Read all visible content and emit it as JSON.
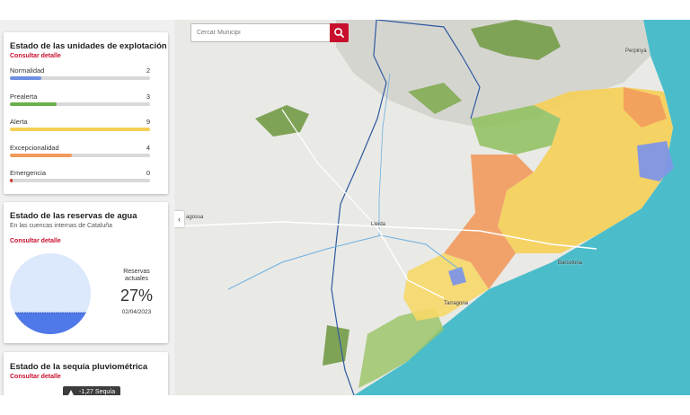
{
  "search": {
    "placeholder": "Cercar Municipi"
  },
  "exploitation": {
    "title": "Estado de las unidades de explotación",
    "detail_link": "Consultar detalle",
    "max": 9,
    "rows": [
      {
        "label": "Normalidad",
        "count": "2",
        "value": 2,
        "color": "#6f8fe0"
      },
      {
        "label": "Prealerta",
        "count": "3",
        "value": 3,
        "color": "#6ab04c"
      },
      {
        "label": "Alerta",
        "count": "9",
        "value": 9,
        "color": "#f6cf55"
      },
      {
        "label": "Excepcionalidad",
        "count": "4",
        "value": 4,
        "color": "#f29a5c"
      },
      {
        "label": "Emergencia",
        "count": "0",
        "value": 0,
        "color": "#d0312d"
      }
    ]
  },
  "reserves": {
    "title": "Estado de las reservas de agua",
    "subtitle": "En las cuencas internas de Cataluña",
    "detail_link": "Consultar detalle",
    "label_line1": "Reservas",
    "label_line2": "actuales",
    "percent": "27%",
    "percent_value": 27,
    "date": "02/04/2023"
  },
  "drought": {
    "title": "Estado de la sequía pluviométrica",
    "detail_link": "Consultar detalle",
    "tooltip": "-1,27 Sequía"
  },
  "map": {
    "cities": [
      {
        "name": "Perpinyà"
      },
      {
        "name": "agossa"
      },
      {
        "name": "Lleida"
      },
      {
        "name": "Barcelona"
      },
      {
        "name": "Tarragona"
      }
    ]
  },
  "icons": {
    "search": "search-icon",
    "collapse": "chevron-left-icon",
    "tooltip": "triangle-up-icon"
  }
}
